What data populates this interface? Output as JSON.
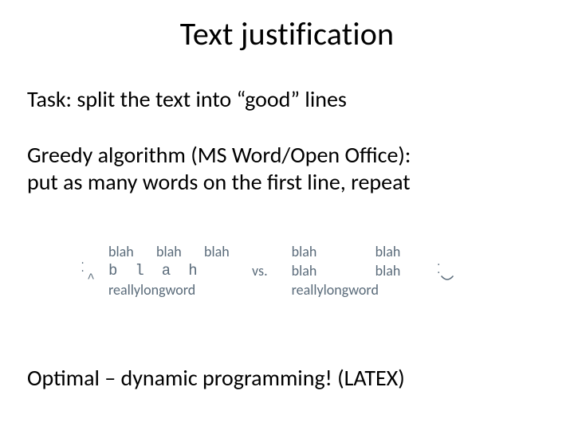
{
  "title": "Text justification",
  "task_line": "Task: split the text into “good” lines",
  "greedy_line1": "Greedy algorithm (MS Word/Open Office):",
  "greedy_line2": "put as many words on the first line, repeat",
  "optimal_line": "Optimal – dynamic programming!  (LATEX)",
  "figure": {
    "left": {
      "row1": [
        "blah",
        "blah",
        "blah"
      ],
      "row2_spaced": "blah",
      "row3": "reallylongword"
    },
    "vs_label": "vs.",
    "right": {
      "row1": [
        "blah",
        "blah"
      ],
      "row2": [
        "blah",
        "blah"
      ],
      "row3": "reallylongword"
    },
    "face_eyes": ". .",
    "sad_mouth": "^",
    "happy_mouth_shape": "smile"
  }
}
